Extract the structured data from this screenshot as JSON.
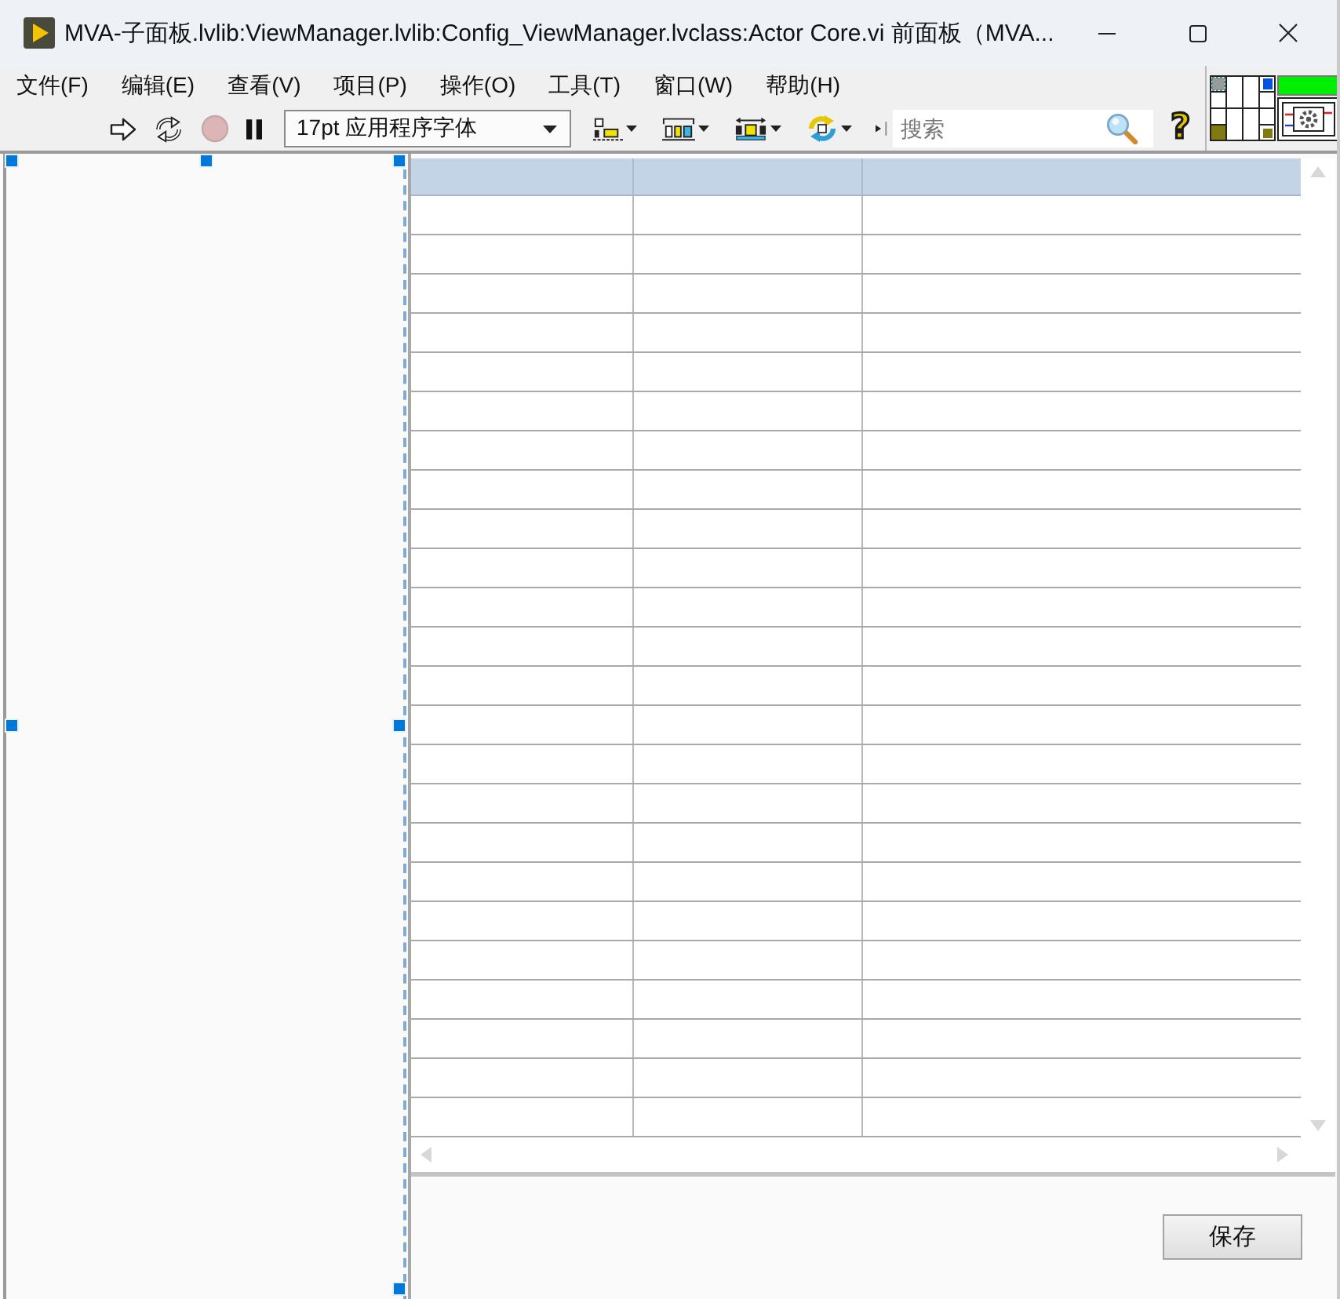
{
  "window": {
    "title": "MVA-子面板.lvlib:ViewManager.lvlib:Config_ViewManager.lvclass:Actor Core.vi 前面板（MVA..."
  },
  "menu": [
    "文件(F)",
    "编辑(E)",
    "查看(V)",
    "项目(P)",
    "操作(O)",
    "工具(T)",
    "窗口(W)",
    "帮助(H)"
  ],
  "toolbar": {
    "buttons": [
      {
        "kind": "run",
        "disabled": false
      },
      {
        "kind": "run_continuously",
        "disabled": false
      },
      {
        "kind": "abort",
        "disabled": true
      },
      {
        "kind": "pause",
        "disabled": false
      }
    ],
    "font_menu": {
      "value": "17pt 应用程序字体"
    },
    "tools": [
      {
        "kind": "align"
      },
      {
        "kind": "distribute"
      },
      {
        "kind": "resize"
      },
      {
        "kind": "reorder"
      }
    ],
    "search": {
      "placeholder": "搜索"
    },
    "help": {
      "label": "?"
    }
  },
  "left_panel": {
    "selected": true
  },
  "listbox": {
    "column_headers": true,
    "vertical_scrollbar": {
      "disabled": true
    },
    "horizontal_scrollbar": {
      "disabled": true
    }
  },
  "save_button": {
    "label": "保存"
  }
}
